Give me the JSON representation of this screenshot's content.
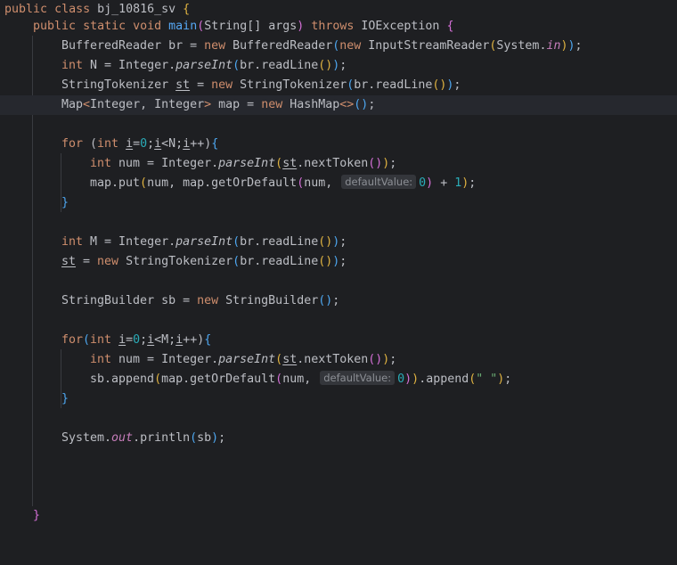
{
  "editor": {
    "l1": {
      "a": "public",
      "b": " ",
      "c": "class",
      "d": " bj_10816_sv ",
      "e": "{"
    },
    "l2": {
      "a": "public",
      "b": " ",
      "c": "static",
      "d": " ",
      "e": "void",
      "f": " ",
      "g": "main",
      "h": "(",
      "i": "String[] args",
      "j": ")",
      "k": " ",
      "l": "throws",
      "m": " IOException ",
      "n": "{"
    },
    "l3": {
      "a": "BufferedReader br = ",
      "b": "new",
      "c": " BufferedReader",
      "d": "(",
      "e": "new",
      "f": " InputStreamReader",
      "g": "(",
      "h": "System.",
      "i": "in",
      "j": ")",
      "k": ")",
      "l": ";"
    },
    "l4": {
      "a": "int",
      "b": " N = Integer.",
      "c": "parseInt",
      "d": "(",
      "e": "br.readLine",
      "f": "()",
      "g": ")",
      "h": ";"
    },
    "l5": {
      "a": "StringTokenizer ",
      "b": "st",
      "c": " = ",
      "d": "new",
      "e": " StringTokenizer",
      "f": "(",
      "g": "br.readLine",
      "h": "()",
      "i": ")",
      "j": ";"
    },
    "l6": {
      "a": "Map",
      "b": "<",
      "c": "Integer, Integer",
      "d": ">",
      "e": " map = ",
      "f": "new",
      "g": " HashMap",
      "h": "<>",
      "i": "()",
      "j": ";"
    },
    "l8": {
      "a": "for",
      "b": " (",
      "c": "int",
      "d": " ",
      "e": "i",
      "f": "=",
      "g": "0",
      "h": ";",
      "i": "i",
      "j": "<N;",
      "k": "i",
      "l": "++)",
      "m": "{"
    },
    "l9": {
      "a": "int",
      "b": " num = Integer.",
      "c": "parseInt",
      "d": "(",
      "e": "st",
      "f": ".nextToken",
      "g": "()",
      "h": ")",
      "i": ";"
    },
    "l10": {
      "a": "map.put",
      "b": "(",
      "c": "num, map.getOrDefault",
      "d": "(",
      "e": "num, ",
      "hint": "defaultValue:",
      "f": "0",
      "g": ")",
      "h": " + ",
      "i": "1",
      "j": ")",
      "k": ";"
    },
    "l11": {
      "a": "}"
    },
    "l13": {
      "a": "int",
      "b": " M = Integer.",
      "c": "parseInt",
      "d": "(",
      "e": "br.readLine",
      "f": "()",
      "g": ")",
      "h": ";"
    },
    "l14": {
      "a": "st",
      "b": " = ",
      "c": "new",
      "d": " StringTokenizer",
      "e": "(",
      "f": "br.readLine",
      "g": "()",
      "h": ")",
      "i": ";"
    },
    "l16": {
      "a": "StringBuilder sb = ",
      "b": "new",
      "c": " StringBuilder",
      "d": "()",
      "e": ";"
    },
    "l18": {
      "a": "for",
      "b": "(",
      "c": "int",
      "d": " ",
      "e": "i",
      "f": "=",
      "g": "0",
      "h": ";",
      "i": "i",
      "j": "<M;",
      "k": "i",
      "l": "++)",
      "m": "{"
    },
    "l19": {
      "a": "int",
      "b": " num = Integer.",
      "c": "parseInt",
      "d": "(",
      "e": "st",
      "f": ".nextToken",
      "g": "()",
      "h": ")",
      "i": ";"
    },
    "l20": {
      "a": "sb.append",
      "b": "(",
      "c": "map.getOrDefault",
      "d": "(",
      "e": "num, ",
      "hint": "defaultValue:",
      "f": "0",
      "g": ")",
      "h": ")",
      "i": ".append",
      "j": "(",
      "k": "\" \"",
      "l": ")",
      "m": ";"
    },
    "l21": {
      "a": "}"
    },
    "l23": {
      "a": "System.",
      "b": "out",
      "c": ".println",
      "d": "(",
      "e": "sb",
      "f": ")",
      "g": ";"
    },
    "l27": {
      "a": "}"
    }
  }
}
